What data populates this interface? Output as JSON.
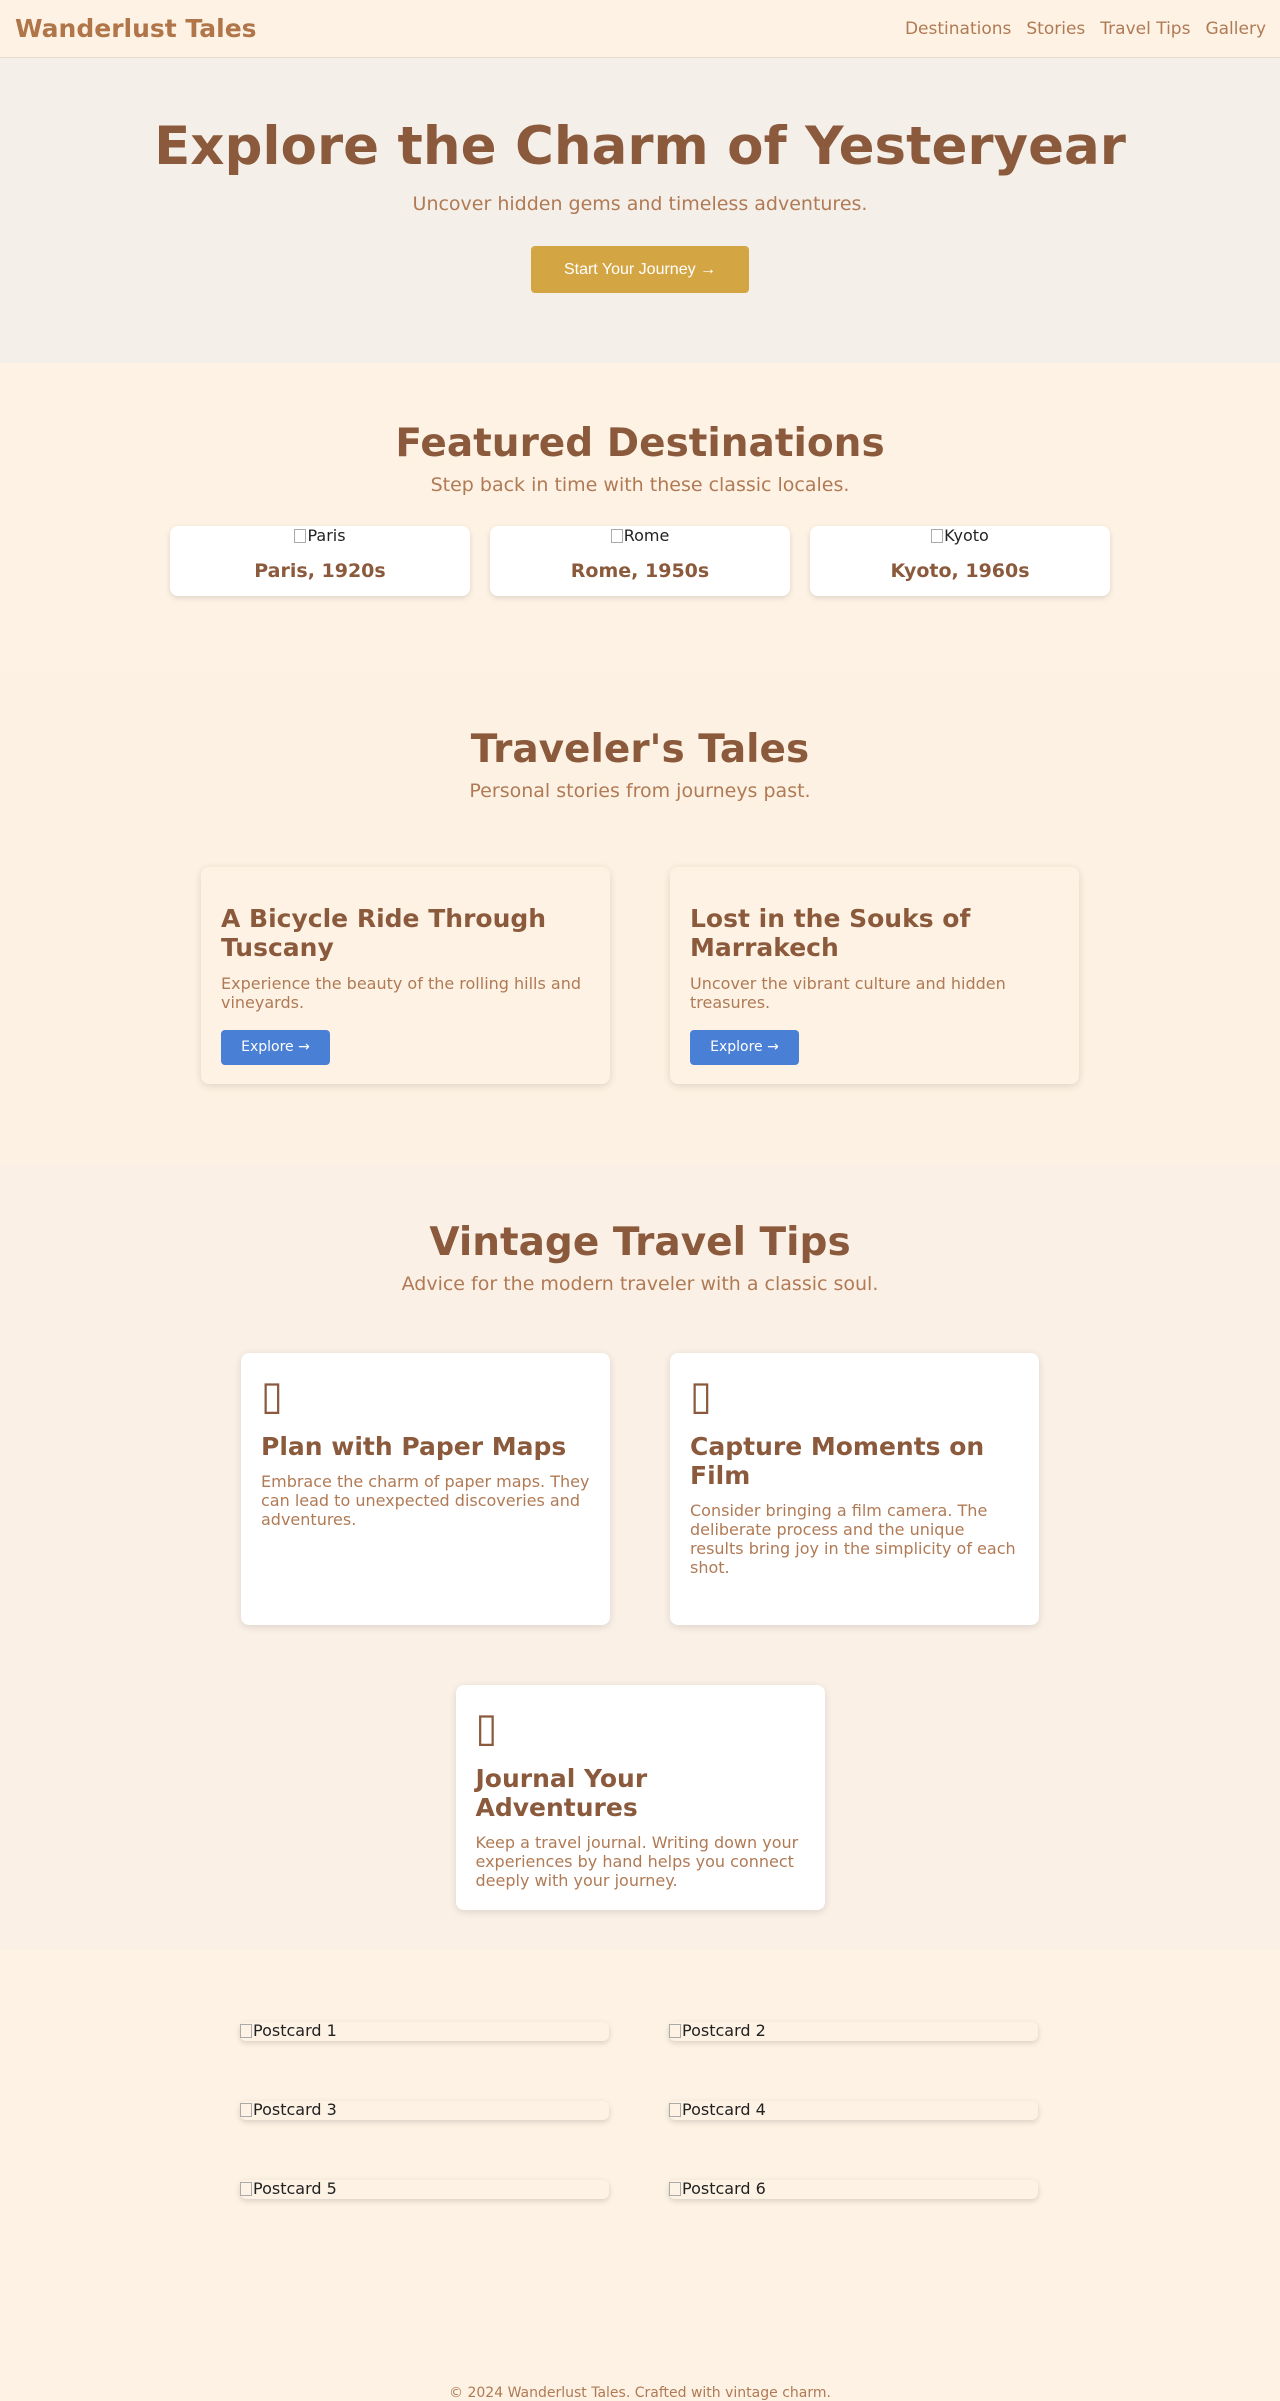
{
  "nav": {
    "brand": "Wanderlust Tales",
    "links": [
      "Destinations",
      "Stories",
      "Travel Tips",
      "Gallery"
    ]
  },
  "hero": {
    "title": "Explore the Charm of Yesteryear",
    "subtitle": "Uncover hidden gems and timeless adventures.",
    "cta": "Start Your Journey →"
  },
  "featured": {
    "title": "Featured Destinations",
    "subtitle": "Step back in time with these classic locales.",
    "cards": [
      {
        "alt": "Paris",
        "name": "Paris, 1920s"
      },
      {
        "alt": "Rome",
        "name": "Rome, 1950s"
      },
      {
        "alt": "Kyoto",
        "name": "Kyoto, 1960s"
      }
    ]
  },
  "tales": {
    "title": "Traveler's Tales",
    "subtitle": "Personal stories from journeys past.",
    "stories": [
      {
        "title": "A Bicycle Ride Through Tuscany",
        "text": "Experience the beauty of the rolling hills and vineyards.",
        "button": "Explore →"
      },
      {
        "title": "Lost in the Souks of Marrakech",
        "text": "Uncover the vibrant culture and hidden treasures.",
        "button": "Explore →"
      }
    ]
  },
  "tips": {
    "title": "Vintage Travel Tips",
    "subtitle": "Advice for the modern traveler with a classic soul.",
    "items": [
      {
        "icon": "map-icon",
        "title": "Plan with Paper Maps",
        "text": "Embrace the charm of paper maps. They can lead to unexpected discoveries and adventures."
      },
      {
        "icon": "camera-icon",
        "title": "Capture Moments on Film",
        "text": "Consider bringing a film camera. The deliberate process and the unique results bring joy in the simplicity of each shot."
      },
      {
        "icon": "journal-icon",
        "title": "Journal Your Adventures",
        "text": "Keep a travel journal. Writing down your experiences by hand helps you connect deeply with your journey."
      }
    ]
  },
  "gallery": {
    "postcards": [
      "Postcard 1",
      "Postcard 2",
      "Postcard 3",
      "Postcard 4",
      "Postcard 5",
      "Postcard 6"
    ]
  },
  "footer": {
    "text": "© 2024 Wanderlust Tales. Crafted with vintage charm."
  },
  "colors": {
    "brown": "#8b5a3c",
    "tan": "#b07a55",
    "gold": "#d4a543",
    "blue": "#4a7fd6",
    "cream": "#fdf2e4"
  }
}
